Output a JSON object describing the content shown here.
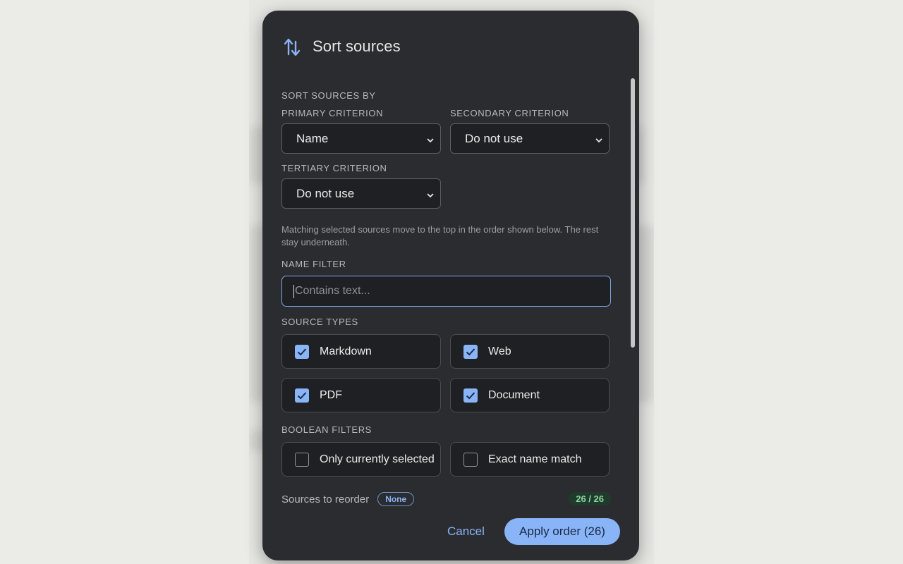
{
  "dialog": {
    "icon": "sort-arrows-icon",
    "title": "Sort sources",
    "section_sort_by": "SORT SOURCES BY",
    "primary": {
      "label": "PRIMARY CRITERION",
      "value": "Name"
    },
    "secondary": {
      "label": "SECONDARY CRITERION",
      "value": "Do not use"
    },
    "tertiary": {
      "label": "TERTIARY CRITERION",
      "value": "Do not use"
    },
    "hint": "Matching selected sources move to the top in the order shown below. The rest stay underneath.",
    "name_filter": {
      "label": "NAME FILTER",
      "placeholder": "Contains text...",
      "value": ""
    },
    "source_types": {
      "label": "SOURCE TYPES",
      "items": [
        {
          "label": "Markdown",
          "checked": true
        },
        {
          "label": "Web",
          "checked": true
        },
        {
          "label": "PDF",
          "checked": true
        },
        {
          "label": "Document",
          "checked": true
        }
      ]
    },
    "boolean_filters": {
      "label": "BOOLEAN FILTERS",
      "items": [
        {
          "label": "Only currently selected",
          "checked": false
        },
        {
          "label": "Exact name match",
          "checked": false
        }
      ]
    },
    "reorder": {
      "label": "Sources to reorder",
      "pill": "None",
      "count": "26 / 26"
    },
    "footer": {
      "cancel_label": "Cancel",
      "apply_label": "Apply order (26)"
    }
  },
  "colors": {
    "accent": "#8ab4f8",
    "dialog_bg": "#2b2c2f",
    "success": "#8fd3a4"
  }
}
